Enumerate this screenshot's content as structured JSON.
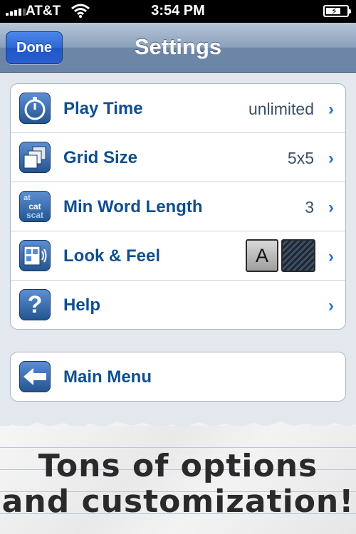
{
  "status": {
    "carrier": "AT&T",
    "time": "3:54 PM"
  },
  "nav": {
    "done_label": "Done",
    "title": "Settings"
  },
  "settings_rows": [
    {
      "label": "Play Time",
      "value": "unlimited",
      "icon": "stopwatch-icon"
    },
    {
      "label": "Grid Size",
      "value": "5x5",
      "icon": "grid-size-icon"
    },
    {
      "label": "Min Word Length",
      "value": "3",
      "icon": "word-length-icon",
      "icon_text": [
        "at",
        "cat",
        "scat"
      ]
    },
    {
      "label": "Look & Feel",
      "icon": "look-and-feel-icon",
      "swatch_letter": "A"
    },
    {
      "label": "Help",
      "icon": "help-icon",
      "icon_text": "?"
    }
  ],
  "menu_row": {
    "label": "Main Menu",
    "icon": "back-arrow-icon"
  },
  "tagline": {
    "line1": "Tons of options",
    "line2": "and customization!"
  },
  "colors": {
    "accent": "#0f4f8f",
    "chevron": "#2d72c8",
    "done_button": "#2e67d8",
    "nav_bar": "#8aa0bd"
  }
}
